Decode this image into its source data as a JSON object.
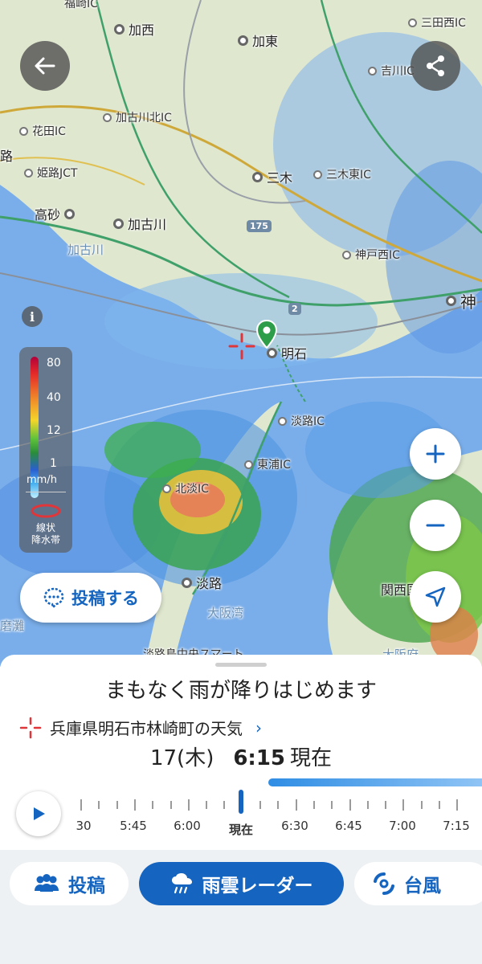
{
  "map": {
    "places": [
      {
        "name": "福崎IC",
        "kind": "ic"
      },
      {
        "name": "加西",
        "kind": "city"
      },
      {
        "name": "加東",
        "kind": "city"
      },
      {
        "name": "三田西IC",
        "kind": "ic"
      },
      {
        "name": "吉川IC",
        "kind": "ic"
      },
      {
        "name": "加古川北IC",
        "kind": "ic"
      },
      {
        "name": "花田IC",
        "kind": "ic"
      },
      {
        "name": "姫路JCT",
        "kind": "ic"
      },
      {
        "name": "路",
        "kind": "city"
      },
      {
        "name": "三木",
        "kind": "city"
      },
      {
        "name": "三木東IC",
        "kind": "ic"
      },
      {
        "name": "高砂",
        "kind": "city"
      },
      {
        "name": "加古川",
        "kind": "city"
      },
      {
        "name": "加古川",
        "kind": "water"
      },
      {
        "name": "神戸西IC",
        "kind": "ic"
      },
      {
        "name": "神",
        "kind": "city"
      },
      {
        "name": "明石",
        "kind": "city"
      },
      {
        "name": "淡路IC",
        "kind": "ic"
      },
      {
        "name": "東浦IC",
        "kind": "ic"
      },
      {
        "name": "北淡IC",
        "kind": "ic"
      },
      {
        "name": "淡路",
        "kind": "city"
      },
      {
        "name": "大阪湾",
        "kind": "water"
      },
      {
        "name": "関西国際空港",
        "kind": "city"
      },
      {
        "name": "磨灘",
        "kind": "water"
      },
      {
        "name": "淡路島中央スマート",
        "kind": "ic"
      },
      {
        "name": "大阪府",
        "kind": "water"
      }
    ],
    "road_numbers": [
      "175",
      "2"
    ]
  },
  "legend": {
    "ticks": [
      "80",
      "40",
      "12",
      "1"
    ],
    "unit": "mm/h",
    "band_label": "線状\n降水帯"
  },
  "post_button": {
    "label": "投稿する"
  },
  "sheet": {
    "headline": "まもなく雨が降りはじめます",
    "location": "兵庫県明石市林崎町の天気",
    "date": "17(木)",
    "time": "6:15",
    "time_suffix": "現在",
    "timeline_labels": [
      "30",
      "5:45",
      "6:00",
      "現在",
      "6:30",
      "6:45",
      "7:00",
      "7:15"
    ]
  },
  "nav": {
    "post": "投稿",
    "radar": "雨雲レーダー",
    "typhoon": "台風"
  },
  "colors": {
    "accent": "#1565c0",
    "sea": "#6fa3e6",
    "land": "#dfe7cf"
  }
}
